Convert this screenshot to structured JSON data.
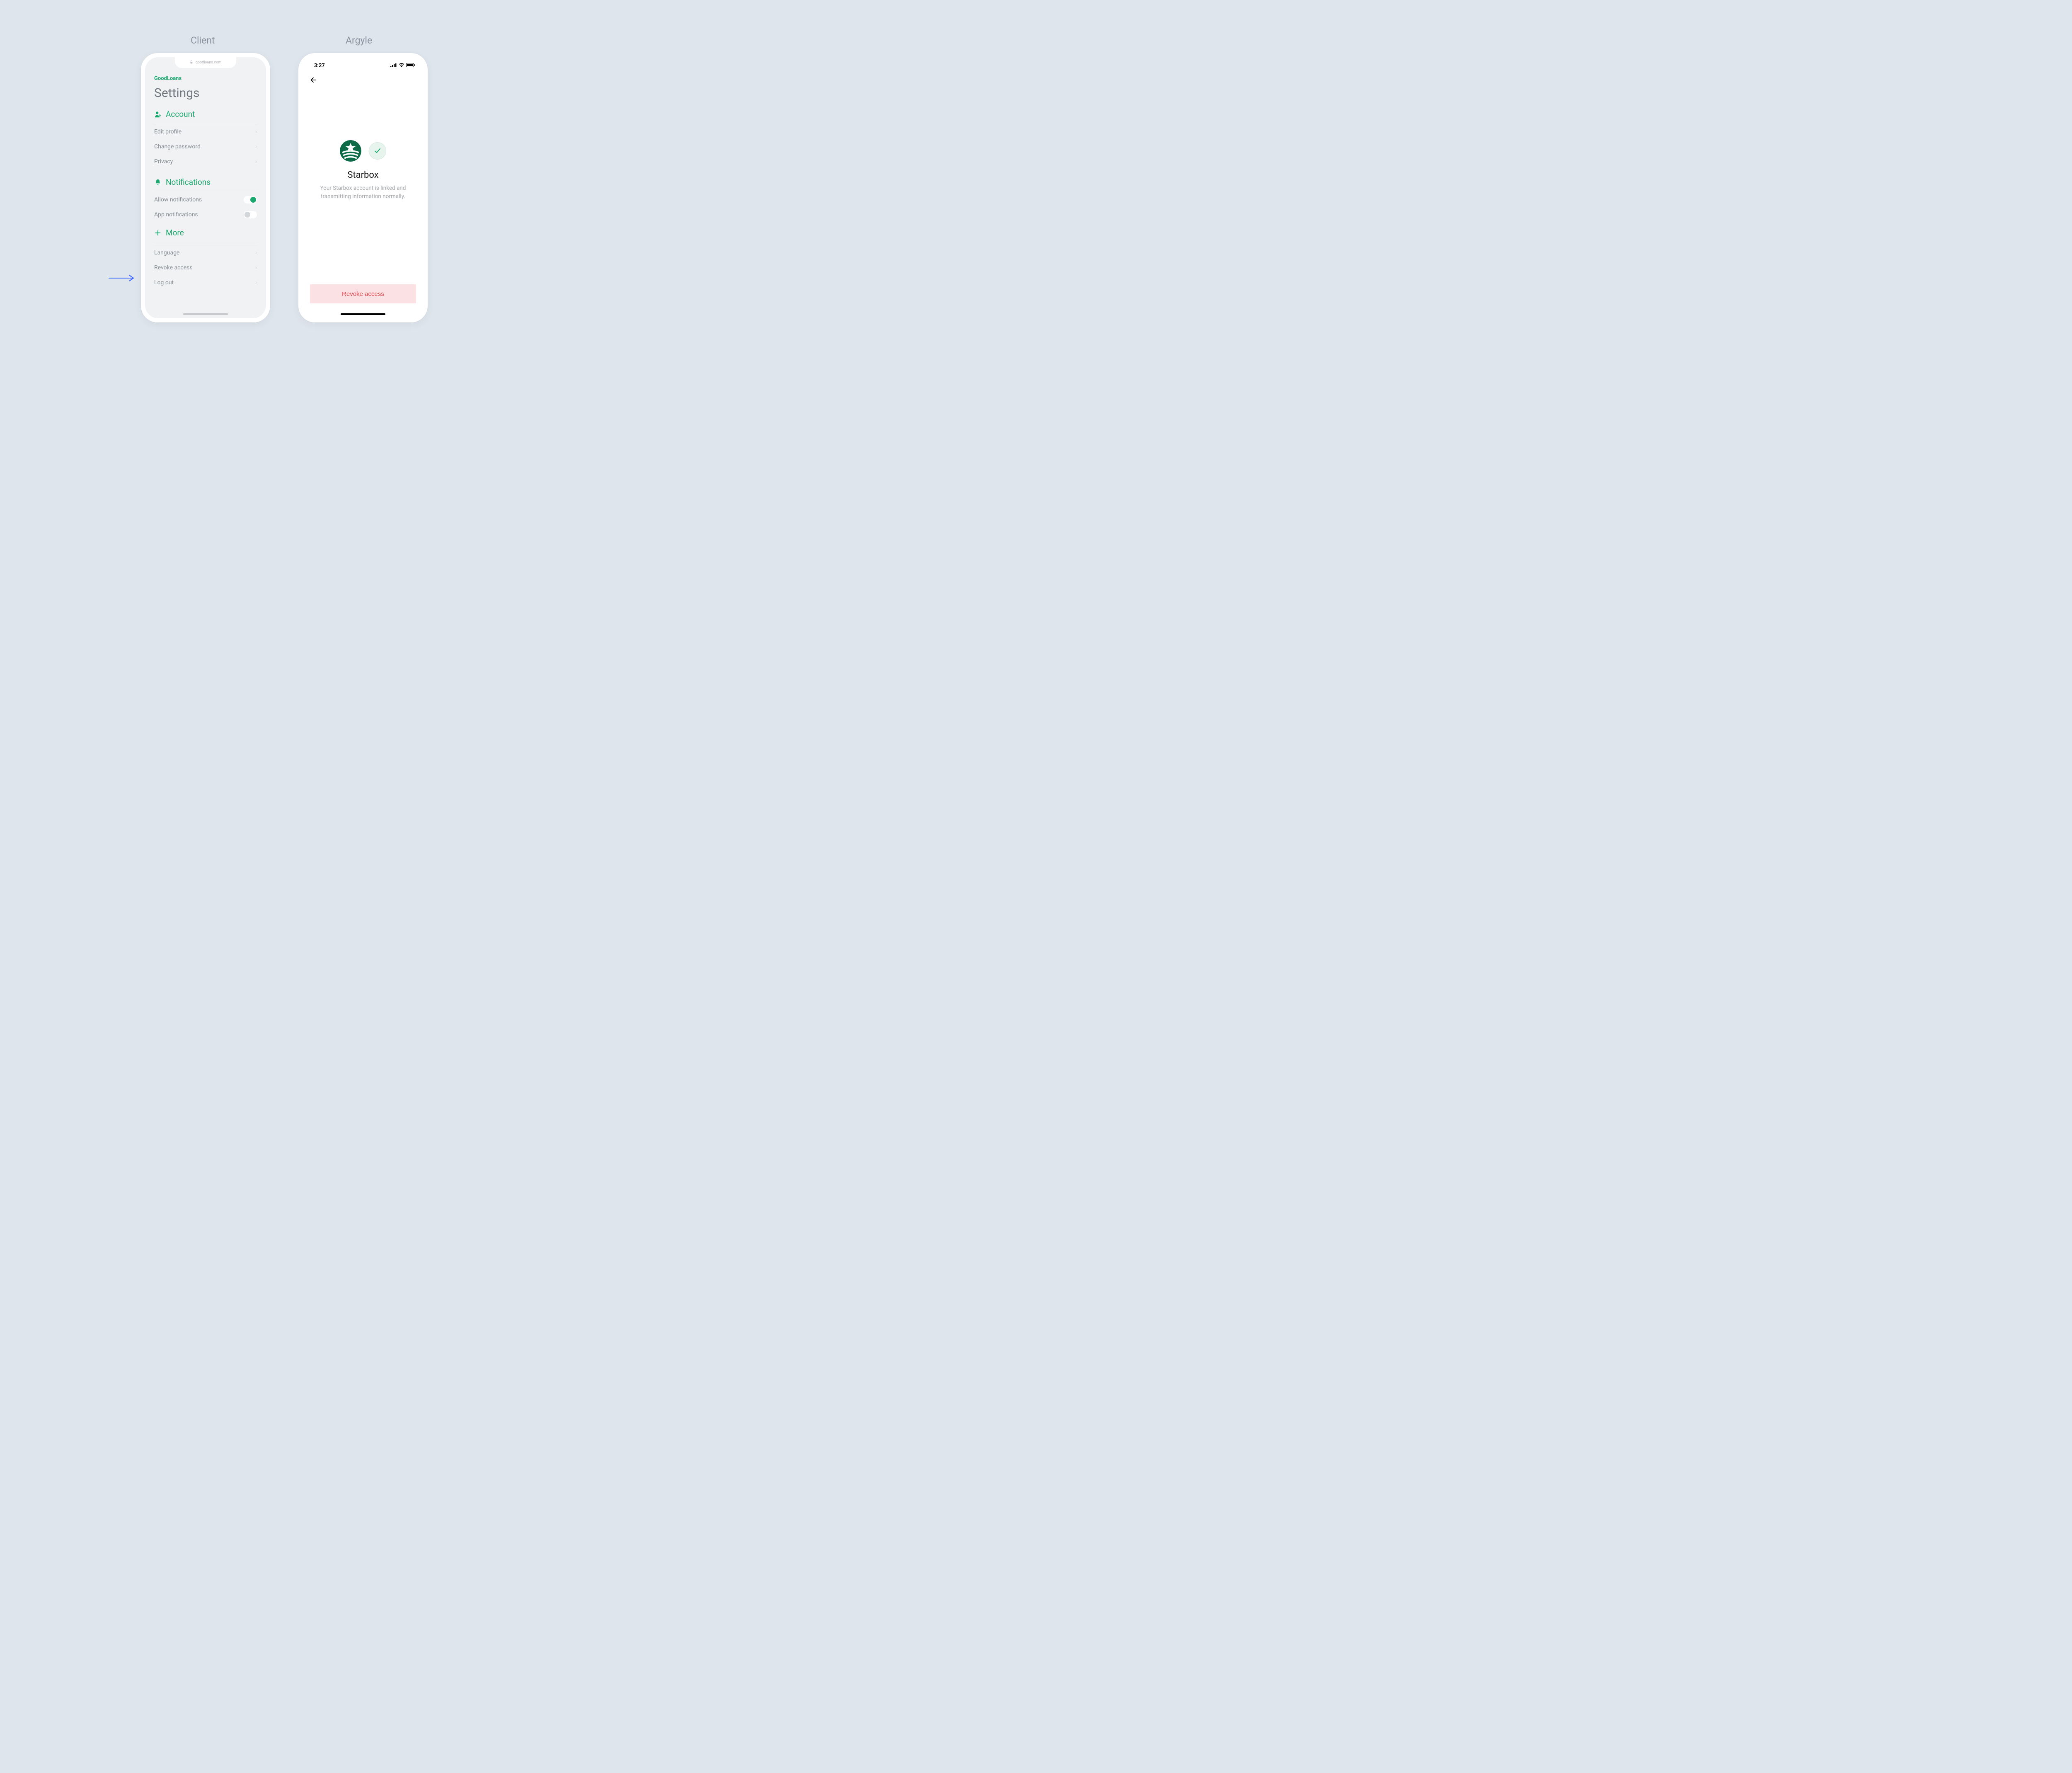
{
  "headers": {
    "client": "Client",
    "argyle": "Argyle"
  },
  "client": {
    "url": "goodloans.com",
    "brand": "GoodLoans",
    "title": "Settings",
    "sections": {
      "account": {
        "label": "Account",
        "items": [
          "Edit profile",
          "Change password",
          "Privacy"
        ]
      },
      "notifications": {
        "label": "Notifications",
        "items": [
          {
            "label": "Allow notifications",
            "on": true
          },
          {
            "label": "App notifications",
            "on": false
          }
        ]
      },
      "more": {
        "label": "More",
        "items": [
          "Language",
          "Revoke access",
          "Log out"
        ]
      }
    }
  },
  "argyle": {
    "time": "3:27",
    "linked_title": "Starbox",
    "linked_desc": "Your Starbox account is linked and transmitting information normally.",
    "revoke_label": "Revoke access"
  }
}
